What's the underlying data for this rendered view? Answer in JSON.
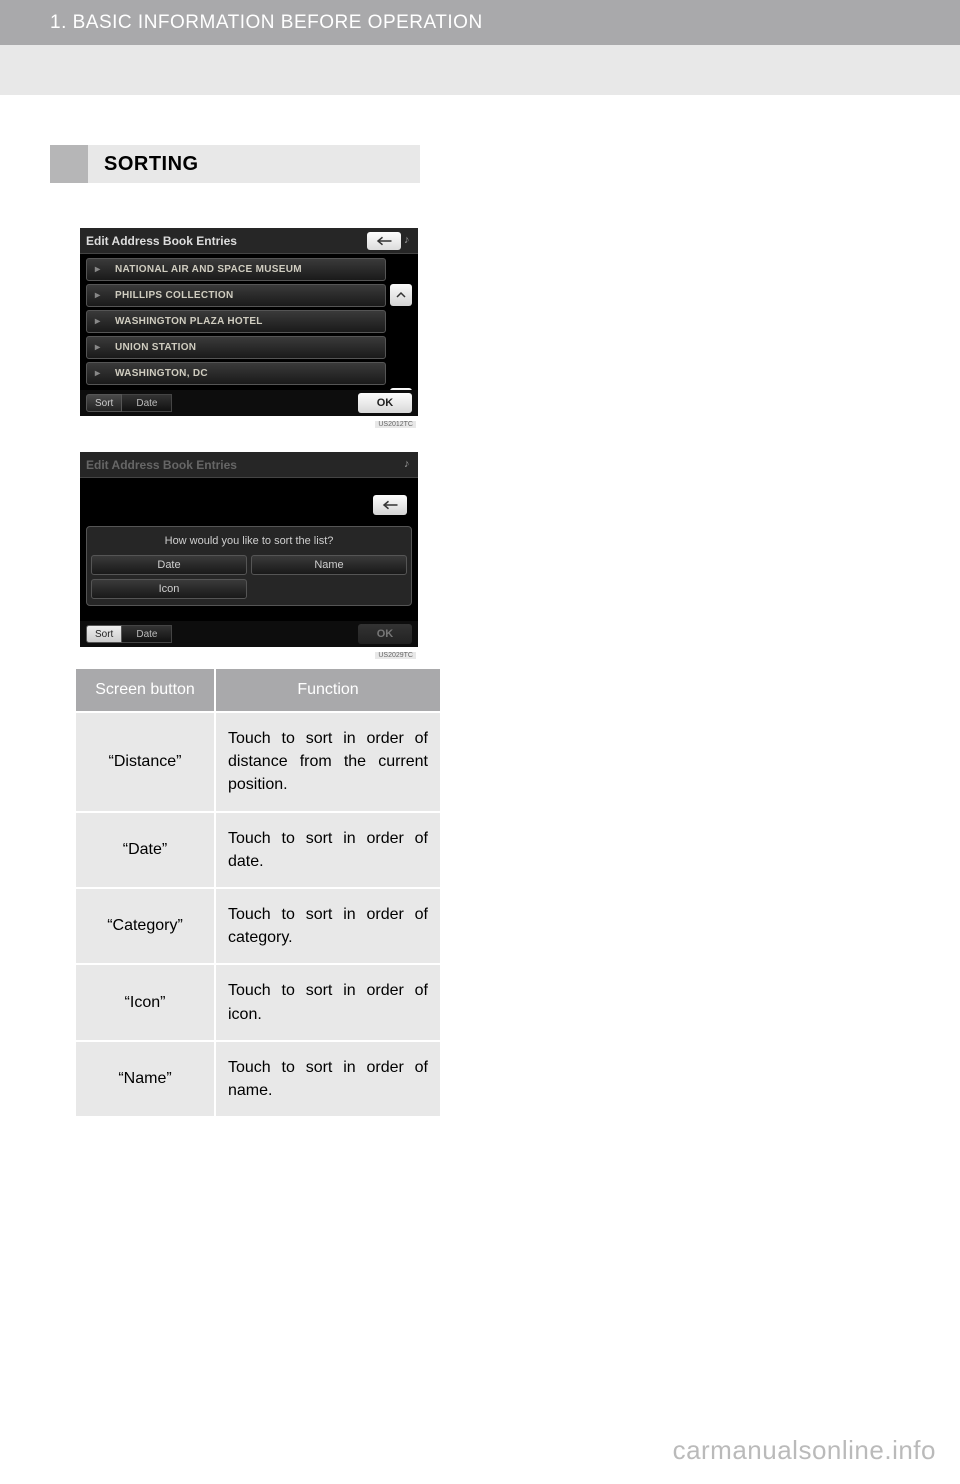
{
  "header": {
    "chapter": "1. BASIC INFORMATION BEFORE OPERATION"
  },
  "section": {
    "title": "SORTING"
  },
  "screenshot1": {
    "title": "Edit Address Book Entries",
    "code": "US2012TC",
    "entries": [
      "NATIONAL AIR AND SPACE MUSEUM",
      "PHILLIPS COLLECTION",
      "WASHINGTON PLAZA HOTEL",
      "UNION STATION",
      "WASHINGTON, DC"
    ],
    "sort_label": "Sort",
    "date_label": "Date",
    "ok_label": "OK"
  },
  "screenshot2": {
    "title": "Edit Address Book Entries",
    "code": "US2029TC",
    "prompt": "How would you like to sort the list?",
    "options": {
      "date": "Date",
      "name": "Name",
      "icon": "Icon"
    },
    "sort_label": "Sort",
    "date_label": "Date",
    "ok_label": "OK"
  },
  "table": {
    "head": {
      "col1": "Screen button",
      "col2": "Function"
    },
    "rows": [
      {
        "button": "“Distance”",
        "desc": "Touch to sort in order of distance from the current position."
      },
      {
        "button": "“Date”",
        "desc": "Touch to sort in order of date."
      },
      {
        "button": "“Category”",
        "desc": "Touch to sort in order of category."
      },
      {
        "button": "“Icon”",
        "desc": "Touch to sort in order of icon."
      },
      {
        "button": "“Name”",
        "desc": "Touch to sort in order of name."
      }
    ]
  },
  "watermark": "carmanualsonline.info"
}
